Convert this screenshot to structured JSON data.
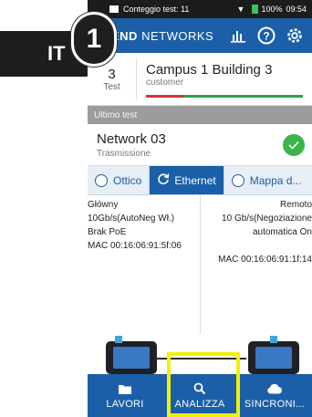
{
  "overlay": {
    "language_badge": "IT",
    "step_number": "1"
  },
  "status_bar": {
    "notification": "Conteggio test: 11",
    "battery": "100%",
    "time": "09:54"
  },
  "app_bar": {
    "brand_bold": "END",
    "brand_rest": "NETWORKS",
    "icons": [
      "chart-icon",
      "help-icon",
      "settings-gear-icon"
    ]
  },
  "job": {
    "count": "3",
    "count_label": "Test",
    "title": "Campus 1 Building 3",
    "subtitle": "customer"
  },
  "last_test": {
    "header": "Ultimo test",
    "name": "Network 03",
    "type": "Trasmissione",
    "status": "pass"
  },
  "tabs": [
    {
      "label": "Ottico",
      "active": false
    },
    {
      "label": "Ethernet",
      "active": true
    },
    {
      "label": "Mappa d...",
      "active": false
    }
  ],
  "results": {
    "left": {
      "heading": "Główny",
      "speed": "10Gb/s(AutoNeg Wł.)",
      "poe": "Brak PoE",
      "mac": "MAC 00:16:06:91:5f:06"
    },
    "right": {
      "heading": "Remoto",
      "speed_line1": "10 Gb/s(Negoziazione",
      "speed_line2": "automatica On",
      "mac": "MAC 00:16:06:91:1f:14"
    }
  },
  "bottom_nav": [
    {
      "label": "LAVORI",
      "icon": "folder-icon"
    },
    {
      "label": "ANALIZZA",
      "icon": "search-icon"
    },
    {
      "label": "SINCRONI...",
      "icon": "cloud-icon"
    }
  ],
  "colors": {
    "primary": "#1b5fa8",
    "highlight": "#f2f200",
    "pass": "#39b54a",
    "fail_bar": "#d5343a"
  }
}
